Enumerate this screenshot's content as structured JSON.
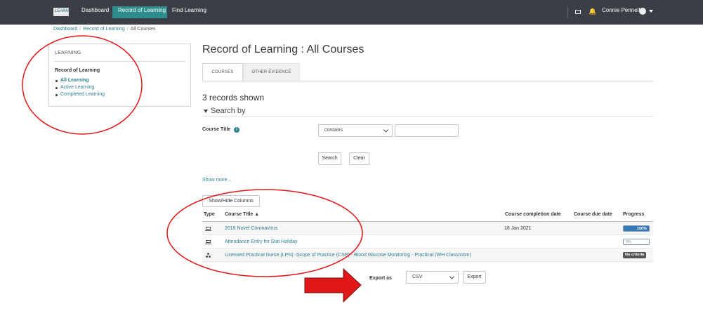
{
  "nav": {
    "logo_text": "LEARN",
    "items": [
      "Dashboard",
      "Record of Learning",
      "Find Learning"
    ],
    "active_item": "Record of Learning",
    "user_name": "Connie Pennell"
  },
  "breadcrumb": [
    "Dashboard",
    "Record of Learning",
    "All Courses"
  ],
  "sidebar": {
    "title": "LEARNING",
    "section": "Record of Learning",
    "items": [
      "All Learning",
      "Active Learning",
      "Completed Learning"
    ],
    "active_item": "All Learning"
  },
  "main": {
    "title": "Record of Learning : All Courses",
    "tabs": [
      "COURSES",
      "OTHER EVIDENCE"
    ],
    "active_tab": "COURSES",
    "records_shown": "3 records shown",
    "search_by": "Search by",
    "filter": {
      "label": "Course Title",
      "operator": "contains",
      "value": ""
    },
    "search_button": "Search",
    "clear_button": "Clear",
    "show_more": "Show more...",
    "show_hide_columns": "Show/Hide Columns",
    "table": {
      "columns": [
        "Type",
        "Course Title",
        "Course completion date",
        "Course due date",
        "Progress"
      ],
      "sorted_by": "Course Title",
      "sort_direction": "ascending",
      "rows": [
        {
          "type_icon": "laptop-icon",
          "title": "2019 Novel Coronavirus",
          "completion_date": "18 Jan 2021",
          "due_date": "",
          "progress_text": "100%",
          "progress_value": 100
        },
        {
          "type_icon": "laptop-icon",
          "title": "Attendance Entry for Stat Holiday",
          "completion_date": "",
          "due_date": "",
          "progress_text": "0%",
          "progress_value": 0
        },
        {
          "type_icon": "people-icon",
          "title": "Licensed Practical Nurse (LPN) -Scope of Practice (CSP) - Blood Glucose Monitoring - Practical (WH Classroom)",
          "completion_date": "",
          "due_date": "",
          "progress_text": "No criteria",
          "progress_value": null
        }
      ]
    },
    "export": {
      "label": "Export as",
      "format": "CSV",
      "button": "Export"
    }
  },
  "colors": {
    "nav_bg": "#3b3f45",
    "nav_active": "#2d8c8c",
    "link": "#2c7f89",
    "progress": "#337ab7",
    "annotation_red": "#e01818"
  }
}
